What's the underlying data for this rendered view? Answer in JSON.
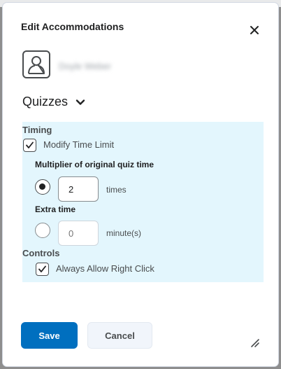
{
  "dialog": {
    "title": "Edit Accommodations",
    "close_icon": "close-icon"
  },
  "user": {
    "avatar_icon": "user-silhouette-icon",
    "name": "Doyle Weber"
  },
  "section": {
    "label": "Quizzes",
    "chevron_icon": "chevron-down-icon"
  },
  "timing": {
    "heading": "Timing",
    "modify_time_limit": {
      "label": "Modify Time Limit",
      "checked": true
    },
    "multiplier": {
      "heading": "Multiplier of original quiz time",
      "selected": true,
      "value": "2",
      "unit": "times"
    },
    "extra_time": {
      "heading": "Extra time",
      "selected": false,
      "placeholder": "0",
      "unit": "minute(s)"
    }
  },
  "controls": {
    "heading": "Controls",
    "always_allow_right_click": {
      "label": "Always Allow Right Click",
      "checked": true
    }
  },
  "footer": {
    "save_label": "Save",
    "cancel_label": "Cancel",
    "resize_icon": "resize-grip-icon"
  },
  "colors": {
    "primary": "#006fbf",
    "panel_bg": "#e3f6fd",
    "text": "#494c4e"
  }
}
